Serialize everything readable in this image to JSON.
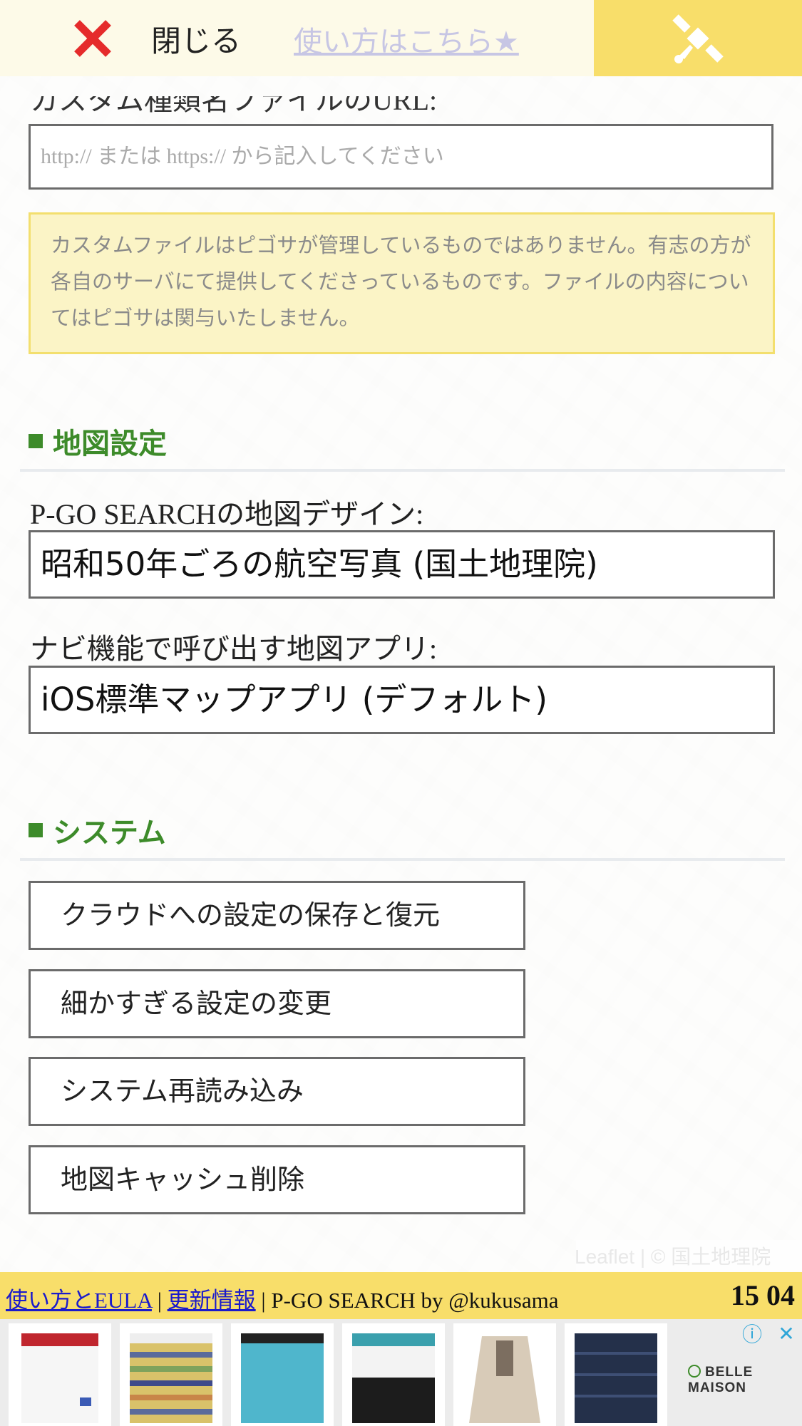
{
  "topbar": {
    "close_label": "閉じる",
    "howto_link": "使い方はこちら★",
    "satellite_icon": "satellite-icon"
  },
  "custom_file": {
    "label": "カスタム種類名ファイルのURL:",
    "placeholder": "http:// または https:// から記入してください",
    "notice": "カスタムファイルはピゴサが管理しているものではありません。有志の方が各自のサーバにて提供してくださっているものです。ファイルの内容についてはピゴサは関与いたしません。"
  },
  "map_settings": {
    "heading": "地図設定",
    "design_label": "P-GO SEARCHの地図デザイン:",
    "design_value": "昭和50年ごろの航空写真 (国土地理院)",
    "nav_label": "ナビ機能で呼び出す地図アプリ:",
    "nav_value": "iOS標準マップアプリ (デフォルト)"
  },
  "system": {
    "heading": "システム",
    "buttons": [
      "クラウドへの設定の保存と復元",
      "細かすぎる設定の変更",
      "システム再読み込み",
      "地図キャッシュ削除"
    ]
  },
  "map": {
    "attribution": "Leaflet | © 国土地理院"
  },
  "footer": {
    "link_eula": "使い方とEULA",
    "separator1": " | ",
    "link_updates": "更新情報",
    "credit": " | P-GO SEARCH by @kukusama",
    "clock": "15 04"
  },
  "ad": {
    "brand": "BELLE MAISON",
    "info_icon": "info-icon",
    "close_icon": "close-icon",
    "colors": {
      "banner_yellow": "#f8de6a",
      "heading_green": "#3d8b2a",
      "close_red": "#e52b2b"
    }
  }
}
